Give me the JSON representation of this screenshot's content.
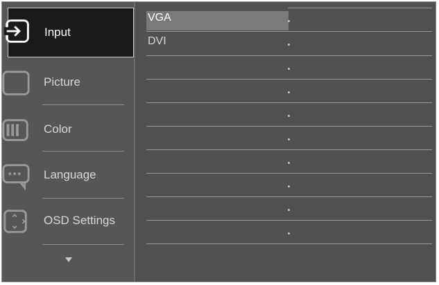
{
  "menu": {
    "items": [
      {
        "label": "Input",
        "icon": "input-icon",
        "selected": true
      },
      {
        "label": "Picture",
        "icon": "picture-icon",
        "selected": false
      },
      {
        "label": "Color",
        "icon": "color-icon",
        "selected": false
      },
      {
        "label": "Language",
        "icon": "language-icon",
        "selected": false
      },
      {
        "label": "OSD Settings",
        "icon": "osd-settings-icon",
        "selected": false
      }
    ],
    "more_indicator": "chevron-down-icon"
  },
  "submenu": {
    "options": [
      {
        "label": "VGA",
        "highlighted": true
      },
      {
        "label": "DVI",
        "highlighted": false
      },
      {
        "label": "",
        "highlighted": false
      },
      {
        "label": "",
        "highlighted": false
      },
      {
        "label": "",
        "highlighted": false
      },
      {
        "label": "",
        "highlighted": false
      },
      {
        "label": "",
        "highlighted": false
      },
      {
        "label": "",
        "highlighted": false
      },
      {
        "label": "",
        "highlighted": false
      },
      {
        "label": "",
        "highlighted": false
      }
    ]
  },
  "colors": {
    "background": "#505050",
    "selected_bg": "#1a1a1a",
    "highlight": "#7a7a7a",
    "text": "#d8d8d8"
  }
}
